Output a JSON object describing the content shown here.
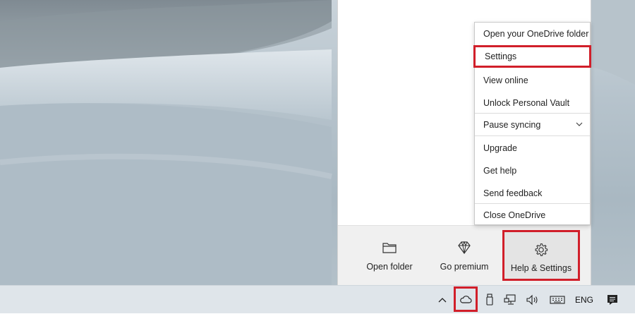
{
  "menu": {
    "items": [
      {
        "label": "Open your OneDrive folder"
      },
      {
        "label": "Settings"
      },
      {
        "label": "View online"
      },
      {
        "label": "Unlock Personal Vault"
      },
      {
        "label": "Pause syncing"
      },
      {
        "label": "Upgrade"
      },
      {
        "label": "Get help"
      },
      {
        "label": "Send feedback"
      },
      {
        "label": "Close OneDrive"
      }
    ]
  },
  "footer": {
    "open_folder": "Open folder",
    "go_premium": "Go premium",
    "help_settings": "Help & Settings"
  },
  "taskbar": {
    "language": "ENG",
    "icons": [
      "chevron-up-icon",
      "onedrive-cloud-icon",
      "usb-drive-icon",
      "network-icon",
      "volume-icon",
      "keyboard-icon",
      "notification-icon"
    ]
  },
  "colors": {
    "highlight_border": "#d11f2a",
    "taskbar_bg": "#dfe5ea",
    "footer_bg": "#f0f0f0"
  }
}
